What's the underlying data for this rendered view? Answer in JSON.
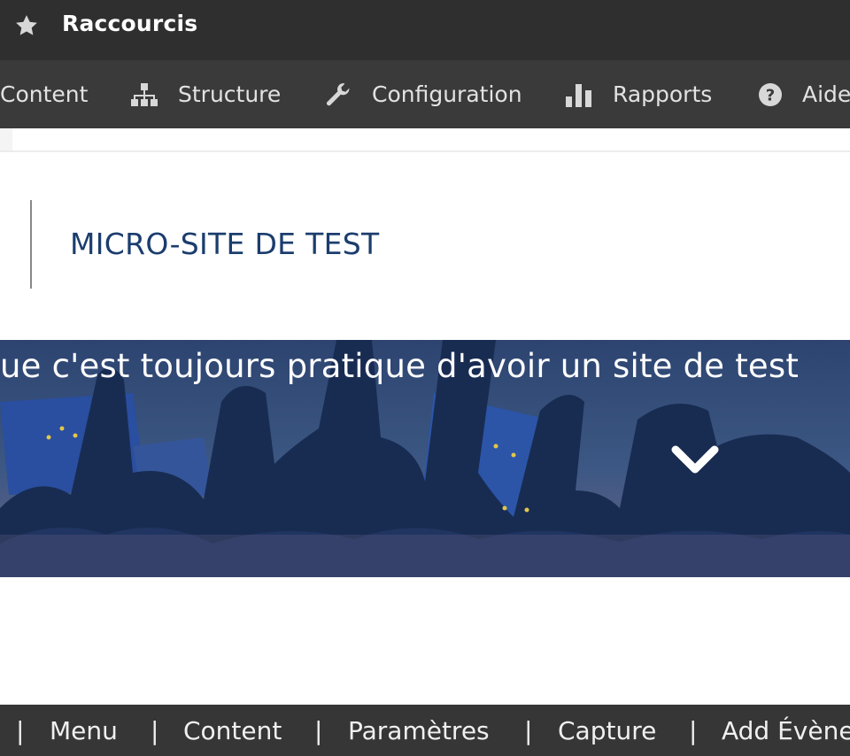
{
  "shortcuts": {
    "icon": "star-icon",
    "title": "Raccourcis"
  },
  "admin_toolbar": {
    "items": [
      {
        "label": "Content",
        "icon": ""
      },
      {
        "label": "Structure",
        "icon": "sitemap-icon"
      },
      {
        "label": "Configuration",
        "icon": "wrench-icon"
      },
      {
        "label": "Rapports",
        "icon": "bar-chart-icon"
      },
      {
        "label": "Aide",
        "icon": "help-circle-icon"
      }
    ]
  },
  "site": {
    "title": "MICRO-SITE DE TEST",
    "title_color": "#1b3d6e"
  },
  "hero": {
    "tagline": "ue c'est toujours pratique d'avoir un site de test",
    "scroll_icon": "chevron-down-icon"
  },
  "bottom_nav": {
    "separator": "|",
    "items": [
      "Menu",
      "Content",
      "Paramètres",
      "Capture",
      "Add Évène"
    ]
  }
}
